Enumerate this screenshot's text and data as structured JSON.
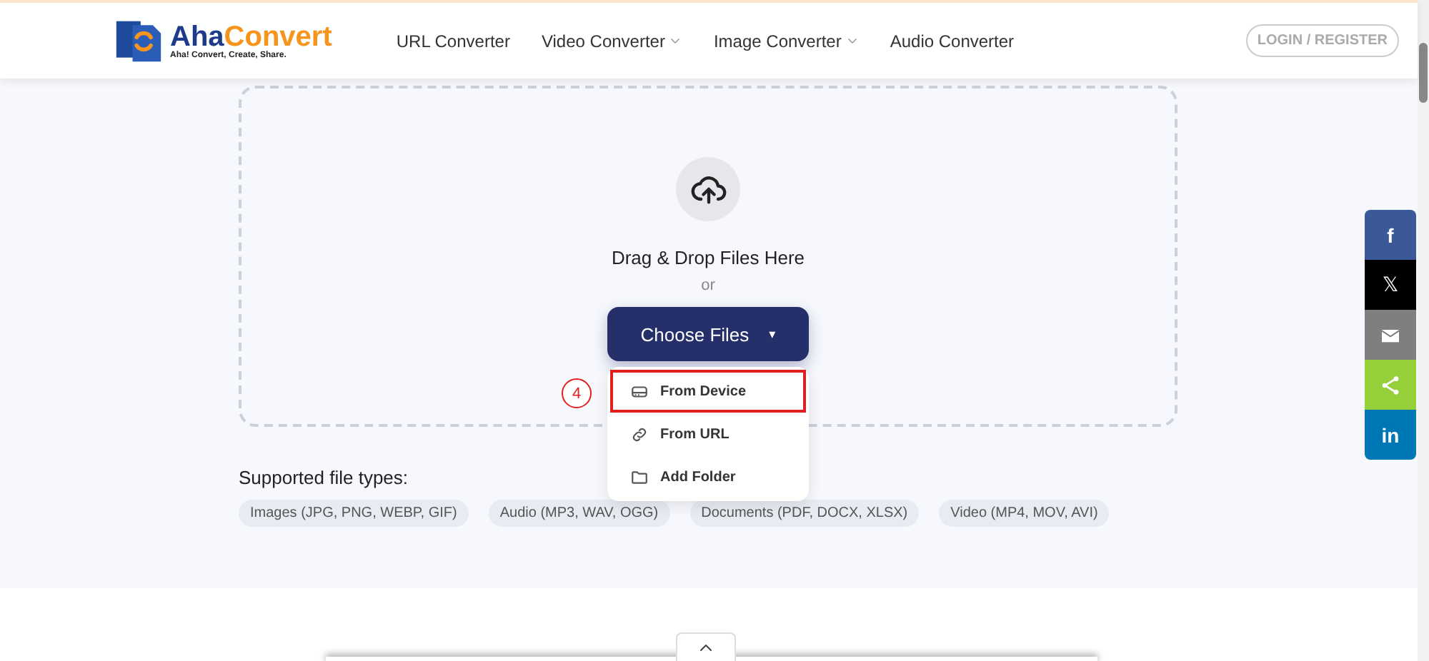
{
  "header": {
    "logo": {
      "name": "Aha",
      "accent": "Convert",
      "tagline": "Aha! Convert, Create, Share."
    },
    "nav": [
      {
        "label": "URL Converter",
        "has_menu": false
      },
      {
        "label": "Video Converter",
        "has_menu": true
      },
      {
        "label": "Image Converter",
        "has_menu": true
      },
      {
        "label": "Audio Converter",
        "has_menu": false
      }
    ],
    "login": "LOGIN / REGISTER"
  },
  "upload": {
    "prompt": "Drag & Drop Files Here",
    "or": "or",
    "button": "Choose Files",
    "button_caret": "▾",
    "menu": [
      {
        "kind": "device",
        "label": "From Device",
        "highlighted": true
      },
      {
        "kind": "url",
        "label": "From URL",
        "highlighted": false
      },
      {
        "kind": "folder",
        "label": "Add Folder",
        "highlighted": false
      }
    ],
    "step_marker": "4"
  },
  "supported": {
    "label": "Supported file types:",
    "types": [
      "Images (JPG, PNG, WEBP, GIF)",
      "Audio (MP3, WAV, OGG)",
      "Documents (PDF, DOCX, XLSX)",
      "Video (MP4, MOV, AVI)"
    ]
  },
  "share": [
    {
      "kind": "facebook",
      "label": "f",
      "color": "#3b5998"
    },
    {
      "kind": "x",
      "label": "𝕏",
      "color": "#000000"
    },
    {
      "kind": "email",
      "color": "#7f7f7f"
    },
    {
      "kind": "share",
      "color": "#95d03a"
    },
    {
      "kind": "linkedin",
      "label": "in",
      "color": "#0077b5"
    }
  ]
}
